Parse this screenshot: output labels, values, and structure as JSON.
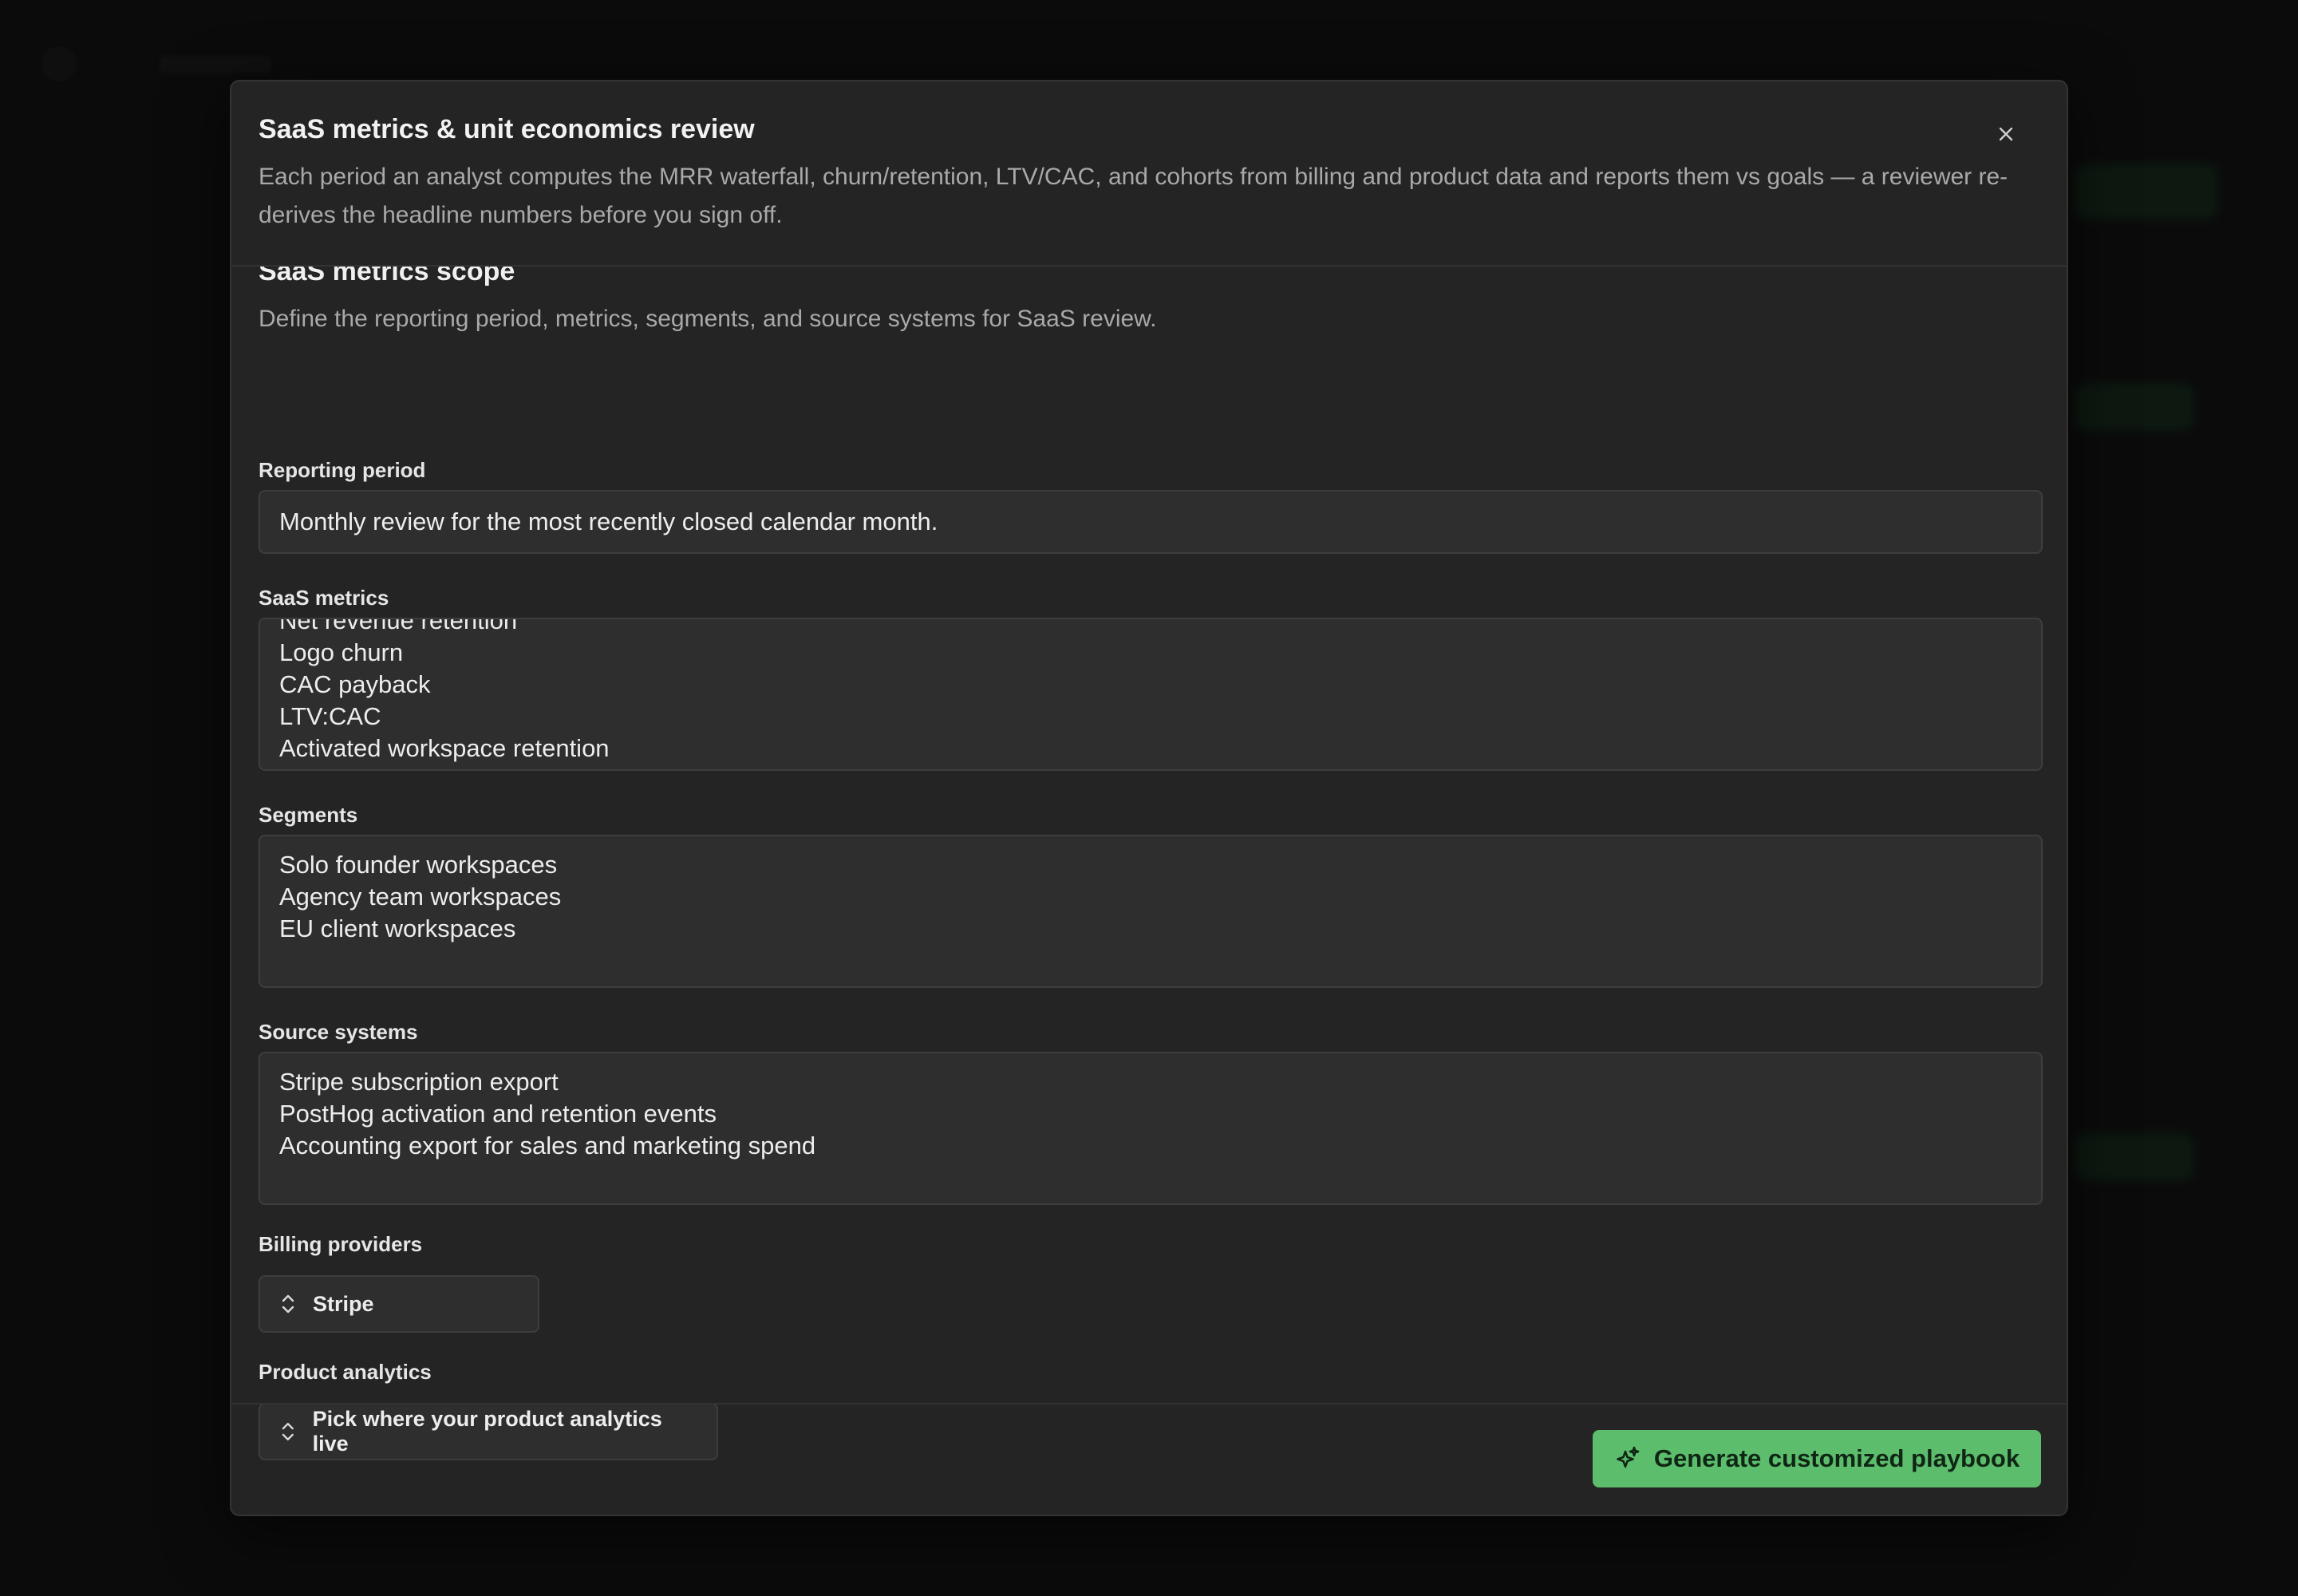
{
  "modal": {
    "title": "SaaS metrics & unit economics review",
    "description": "Each period an analyst computes the MRR waterfall, churn/retention, LTV/CAC, and cohorts from billing and product data and reports them vs goals — a reviewer re-derives the headline numbers before you sign off.",
    "close_icon": "close-icon"
  },
  "scope": {
    "title": "SaaS metrics scope",
    "description": "Define the reporting period, metrics, segments, and source systems for SaaS review."
  },
  "fields": {
    "reporting_period": {
      "label": "Reporting period",
      "value": "Monthly review for the most recently closed calendar month."
    },
    "saas_metrics": {
      "label": "SaaS metrics",
      "lines": [
        "Net revenue retention",
        "Logo churn",
        "CAC payback",
        "LTV:CAC",
        "Activated workspace retention"
      ]
    },
    "segments": {
      "label": "Segments",
      "lines": [
        "Solo founder workspaces",
        "Agency team workspaces",
        "EU client workspaces"
      ]
    },
    "source_systems": {
      "label": "Source systems",
      "lines": [
        "Stripe subscription export",
        "PostHog activation and retention events",
        "Accounting export for sales and marketing spend"
      ]
    },
    "billing_providers": {
      "label": "Billing providers",
      "value": "Stripe",
      "icon": "chevron-up-down-icon"
    },
    "product_analytics": {
      "label": "Product analytics",
      "value": "Pick where your product analytics live",
      "icon": "chevron-up-down-icon"
    }
  },
  "footer": {
    "generate_label": "Generate customized playbook",
    "generate_icon": "sparkles-icon"
  },
  "colors": {
    "accent": "#5cbd6c",
    "modal_bg": "#242424",
    "input_bg": "#2e2e2e"
  }
}
